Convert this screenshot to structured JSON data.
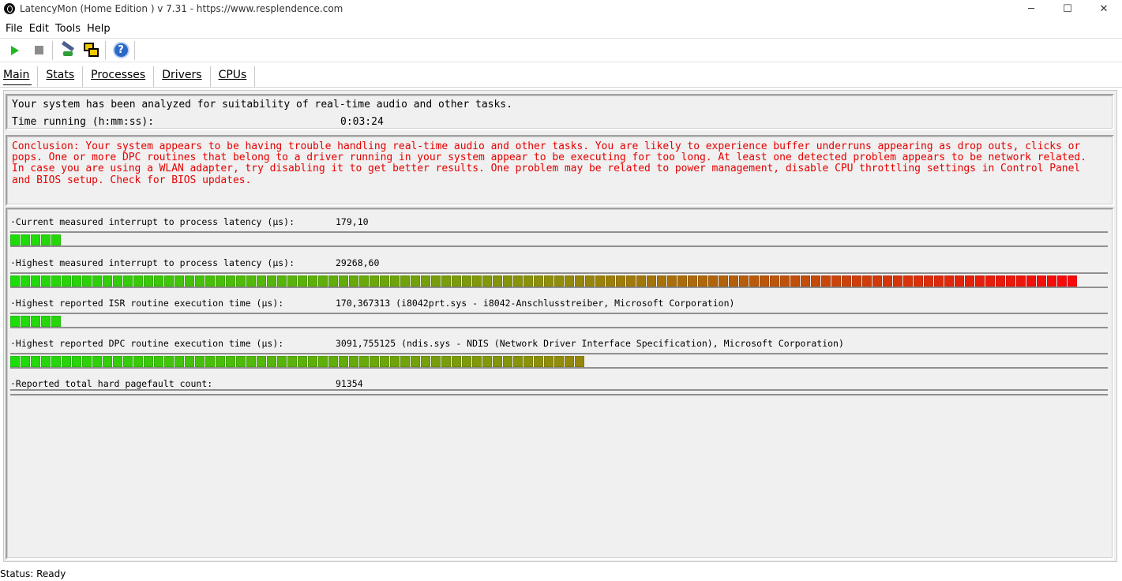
{
  "window": {
    "title": "LatencyMon  (Home Edition )  v 7.31 - https://www.resplendence.com",
    "minimize_glyph": "─",
    "maximize_glyph": "☐",
    "close_glyph": "✕"
  },
  "menu": {
    "items": [
      "File",
      "Edit",
      "Tools",
      "Help"
    ]
  },
  "toolbar": {
    "buttons": [
      "play-icon",
      "stop-icon",
      "key-icon",
      "windows-icon",
      "help-icon"
    ],
    "help_glyph": "?"
  },
  "tabs": [
    "Main",
    "Stats",
    "Processes",
    "Drivers",
    "CPUs"
  ],
  "summary": {
    "line1": "Your system has been analyzed for suitability of real-time audio and other tasks.",
    "time_label": "Time running (h:mm:ss):",
    "time_value": "0:03:24"
  },
  "conclusion": {
    "text": "Conclusion: Your system appears to be having trouble handling real-time audio and other tasks. You are likely to experience buffer underruns appearing as drop outs, clicks or pops. One or more DPC routines that belong to a driver running in your system appear to be executing for too long. At least one detected problem appears to be network related. In case you are using a WLAN adapter, try disabling it to get better results. One problem may be related to power management, disable CPU throttling settings in Control Panel and BIOS setup. Check for BIOS updates.",
    "color": "#e60000"
  },
  "metrics": [
    {
      "label": "·Current measured interrupt to process latency (µs):",
      "value": "179,10",
      "fill_fraction": 0.045
    },
    {
      "label": "·Highest measured interrupt to process latency (µs):",
      "value": "29268,60",
      "fill_fraction": 0.985
    },
    {
      "label": "·Highest reported ISR routine execution time (µs):",
      "value": "170,367313  (i8042prt.sys - i8042-Anschlusstreiber, Microsoft Corporation)",
      "fill_fraction": 0.05
    },
    {
      "label": "·Highest reported DPC routine execution time (µs):",
      "value": "3091,755125  (ndis.sys - NDIS (Network Driver Interface Specification), Microsoft Corporation)",
      "fill_fraction": 0.526
    },
    {
      "label": "·Reported total hard pagefault count:",
      "value": "91354",
      "fill_fraction": 0
    }
  ],
  "status": {
    "text": "Status: Ready"
  }
}
